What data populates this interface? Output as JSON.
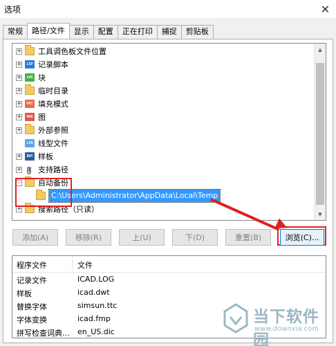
{
  "window": {
    "title": "选项",
    "close_glyph": "✕"
  },
  "tabs": [
    {
      "label": "常规",
      "active": false
    },
    {
      "label": "路径/文件",
      "active": true
    },
    {
      "label": "显示",
      "active": false
    },
    {
      "label": "配置",
      "active": false
    },
    {
      "label": "正在打印",
      "active": false
    },
    {
      "label": "捕捉",
      "active": false
    },
    {
      "label": "剪贴板",
      "active": false
    }
  ],
  "tree": {
    "nodes": [
      {
        "label": "工具调色板文件位置",
        "icon": "folder-icon",
        "expander": "+"
      },
      {
        "label": "记录脚本",
        "icon": "lsp-file-icon",
        "icon_text": "LSP",
        "icon_color": "#2e7bd6",
        "expander": "+"
      },
      {
        "label": "块",
        "icon": "lwi-file-icon",
        "icon_text": "LWI",
        "icon_color": "#48b04a",
        "expander": "+"
      },
      {
        "label": "临时目录",
        "icon": "folder-icon",
        "expander": "+"
      },
      {
        "label": "填充模式",
        "icon": "pat-file-icon",
        "icon_text": "PAT",
        "icon_color": "#e86b4e",
        "expander": "+"
      },
      {
        "label": "图",
        "icon": "dwg-file-icon",
        "icon_text": "DWG",
        "icon_color": "#e0564a",
        "expander": "+"
      },
      {
        "label": "外部参照",
        "icon": "folder-icon",
        "expander": "+"
      },
      {
        "label": "线型文件",
        "icon": "lin-file-icon",
        "icon_text": "LIN",
        "icon_color": "#5aa9e6",
        "expander": ""
      },
      {
        "label": "样板",
        "icon": "dwt-file-icon",
        "icon_text": "DWT",
        "icon_color": "#2a5da8",
        "expander": "+"
      },
      {
        "label": "支持路径",
        "icon": "paperclip-icon",
        "expander": "+"
      },
      {
        "label": "自动备份",
        "icon": "folder-icon",
        "expander": "-"
      },
      {
        "label": "搜索路径（只读）",
        "icon": "folder-icon",
        "expander": "+"
      }
    ],
    "selected_child": {
      "label": "C:\\Users\\Administrator\\AppData\\Local\\Temp",
      "icon": "folder-icon"
    }
  },
  "buttons": {
    "add": "添加(A)",
    "remove": "移除(R)",
    "up": "上(U)",
    "down": "下(D)",
    "reset": "重置(B)",
    "browse": "浏览(C)..."
  },
  "list": {
    "headers": [
      "程序文件",
      "文件"
    ],
    "rows": [
      {
        "name": "记录文件",
        "file": "ICAD.LOG"
      },
      {
        "name": "样板",
        "file": "icad.dwt"
      },
      {
        "name": "替换字体",
        "file": "simsun.ttc"
      },
      {
        "name": "字体变换",
        "file": "icad.fmp"
      },
      {
        "name": "拼写检查词典...",
        "file": "en_US.dic"
      }
    ]
  },
  "watermark": {
    "title": "当下软件园",
    "subtitle": "www.downxia.com"
  },
  "colors": {
    "selection": "#3399ff",
    "highlight_box": "#e02020",
    "focus_border": "#0078d7"
  }
}
